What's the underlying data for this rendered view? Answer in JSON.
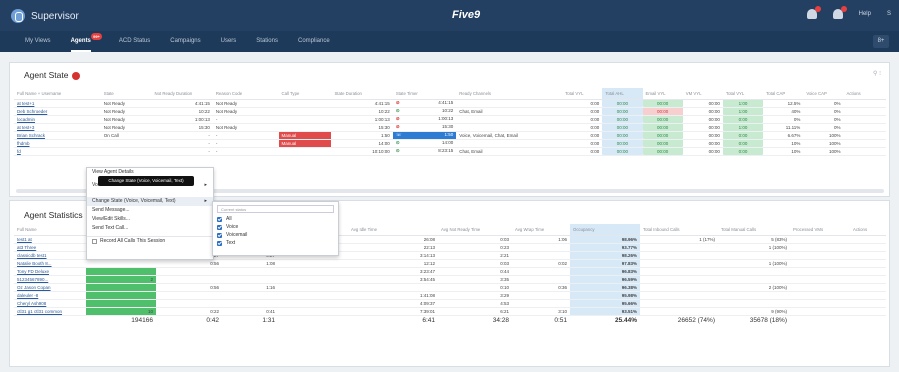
{
  "app": {
    "title": "Supervisor",
    "logo_text": "Five9",
    "help": "Help",
    "user_initial": "S"
  },
  "nav": {
    "items": [
      "My Views",
      "Agents",
      "ACD Status",
      "Campaigns",
      "Users",
      "Stations",
      "Compliance"
    ],
    "agents_badge": "99+",
    "right_btn": "8+"
  },
  "agent_state": {
    "title": "Agent State",
    "columns": [
      "Full Name + Username",
      "State",
      "Not Ready Duration",
      "Reason Code",
      "Call Type",
      "State Duration",
      "State Timer",
      "Ready Channels",
      "Total VYL",
      "Total AHL",
      "Email VYL",
      "VM VYL",
      "Total VYL",
      "Total CAP",
      "Voice CAP",
      "Actions"
    ],
    "rows": [
      {
        "name": "at test+1",
        "state": "Not Ready",
        "nrd": "4:41:15",
        "reason": "Not Ready",
        "call": "",
        "sd": "4:41:15",
        "timer": "4:41:15",
        "timer_icon": "red",
        "channels": "",
        "c1": "0:00",
        "c2": "00:00",
        "c3": "00:00",
        "c4": "00:00",
        "c5": "1:00",
        "c6": "12.5%",
        "c7": "0%",
        "c2c": "g",
        "c3c": "g",
        "c5c": "g"
      },
      {
        "name": "Deb Schroeder",
        "state": "Not Ready",
        "nrd": "10:22",
        "reason": "Not Ready",
        "call": "",
        "sd": "10:22",
        "timer": "10:22",
        "timer_icon": "green",
        "channels": "Chat, Email",
        "c1": "0:00",
        "c2": "00:00",
        "c3": "00:00",
        "c4": "00:00",
        "c5": "1:00",
        "c6": "40%",
        "c7": "0%",
        "c2c": "g",
        "c3c": "r",
        "c5c": "g"
      },
      {
        "name": "locadmin",
        "state": "Not Ready",
        "nrd": "1:00:13",
        "reason": "-",
        "call": "",
        "sd": "1:00:13",
        "timer": "1:00:13",
        "timer_icon": "red",
        "channels": "",
        "c1": "0:00",
        "c2": "00:00",
        "c3": "00:00",
        "c4": "00:00",
        "c5": "0:00",
        "c6": "0%",
        "c7": "0%",
        "c2c": "g",
        "c3c": "g",
        "c5c": "g"
      },
      {
        "name": "at test+3",
        "state": "Not Ready",
        "nrd": "15:30",
        "reason": "Not Ready",
        "call": "",
        "sd": "15:30",
        "timer": "15:30",
        "timer_icon": "red",
        "channels": "",
        "c1": "0:00",
        "c2": "00:00",
        "c3": "00:00",
        "c4": "00:00",
        "c5": "1:00",
        "c6": "11.11%",
        "c7": "0%",
        "c2c": "g",
        "c3c": "g",
        "c5c": "g"
      },
      {
        "name": "Brian Schrack",
        "state": "On Call",
        "nrd": "-",
        "reason": "-",
        "call": "Manual",
        "sd": "1:50",
        "timer": "1:50",
        "timer_icon": "blue",
        "channels": "Voice, Voicemail, Chat, Email",
        "c1": "0:00",
        "c2": "00:00",
        "c3": "00:00",
        "c4": "00:00",
        "c5": "0:00",
        "c6": "6.67%",
        "c7": "100%",
        "c2c": "g",
        "c3c": "g",
        "c5c": "g"
      },
      {
        "name": "fhdmb",
        "state": "",
        "nrd": "-",
        "reason": "-",
        "call": "Manual",
        "sd": "14:00",
        "timer": "14:00",
        "timer_icon": "green",
        "channels": "",
        "c1": "0:00",
        "c2": "00:00",
        "c3": "00:00",
        "c4": "00:00",
        "c5": "0:00",
        "c6": "10%",
        "c7": "100%",
        "c2c": "g",
        "c3c": "g",
        "c5c": "g"
      },
      {
        "name": "fd",
        "state": "",
        "nrd": "-",
        "reason": "-",
        "call": "",
        "sd": "10:10:00",
        "timer": "8:23:15",
        "timer_icon": "green",
        "channels": "Chat, Email",
        "c1": "0:00",
        "c2": "00:00",
        "c3": "00:00",
        "c4": "00:00",
        "c5": "0:00",
        "c6": "10%",
        "c7": "100%",
        "c2c": "g",
        "c3c": "g",
        "c5c": "g"
      }
    ]
  },
  "context_menu": {
    "items": [
      "View Agent Details",
      "Voi",
      "Change State (Voice, Voicemail, Text)",
      "Send Message...",
      "View/Edit Skills...",
      "Send Text Call...",
      "Record All Calls This Session"
    ],
    "tooltip": "Change State (Voice, Voicemail, Text)",
    "submenu": {
      "placeholder": "Current status",
      "options": [
        "All",
        "Voice",
        "Voicemail",
        "Text"
      ]
    }
  },
  "agent_statistics": {
    "title": "Agent Statistics",
    "columns": [
      "Full Name",
      "",
      "",
      "",
      "",
      "Avg Idle Time",
      "Avg Not Ready Time",
      "Avg Wrap Time",
      "Occupancy",
      "Total Inbound Calls",
      "Total Manual Calls",
      "Processed VMs",
      "Actions"
    ],
    "rows": [
      {
        "name": "test1 at",
        "a": "",
        "b": "",
        "c": "",
        "d": "",
        "idle": "26:08",
        "nr": "0:03",
        "wrap": "1:06",
        "occ": "98.96%",
        "inb": "1 (17%)",
        "man": "5 (83%)",
        "vm": ""
      },
      {
        "name": "at3 Three",
        "a": "",
        "b": "",
        "c": "2:42",
        "d": "",
        "idle": "22:13",
        "nr": "0:23",
        "wrap": "",
        "occ": "93.77%",
        "inb": "",
        "man": "1 (100%)",
        "vm": ""
      },
      {
        "name": "classicdb test1",
        "a": "",
        "b": "0:27",
        "c": "0:27",
        "d": "",
        "idle": "3:14:13",
        "nr": "2:21",
        "wrap": "",
        "occ": "98.26%",
        "inb": "",
        "man": "",
        "vm": ""
      },
      {
        "name": "Natalie Booth 8...",
        "a": "",
        "b": "0:56",
        "c": "1:08",
        "d": "",
        "idle": "12:12",
        "nr": "0:03",
        "wrap": "0:02",
        "occ": "97.83%",
        "inb": "",
        "man": "1 (100%)",
        "vm": ""
      },
      {
        "name": "Tony FD Deluxe",
        "a": "",
        "b": "",
        "c": "",
        "d": "",
        "idle": "3:23:47",
        "nr": "0:44",
        "wrap": "",
        "occ": "96.83%",
        "inb": "",
        "man": "",
        "vm": ""
      },
      {
        "name": "51234567890...",
        "a": "2",
        "b": "",
        "c": "",
        "d": "",
        "idle": "3:54:45",
        "nr": "3:35",
        "wrap": "",
        "occ": "96.59%",
        "inb": "",
        "man": "",
        "vm": ""
      },
      {
        "name": "Oz Jason Copan",
        "a": "",
        "b": "0:56",
        "c": "1:16",
        "d": "",
        "idle": "",
        "nr": "0:10",
        "wrap": "0:36",
        "occ": "96.38%",
        "inb": "",
        "man": "2 (100%)",
        "vm": ""
      },
      {
        "name": "daleuler -8",
        "a": "",
        "b": "",
        "c": "",
        "d": "",
        "idle": "1:41:08",
        "nr": "3:29",
        "wrap": "",
        "occ": "95.98%",
        "inb": "",
        "man": "",
        "vm": ""
      },
      {
        "name": "Cheryl Ash908",
        "a": "",
        "b": "",
        "c": "",
        "d": "",
        "idle": "4:09:37",
        "nr": "4:53",
        "wrap": "",
        "occ": "95.66%",
        "inb": "",
        "man": "",
        "vm": ""
      },
      {
        "name": "ctl31 g1 ctl31 common",
        "a": "10",
        "b": "0:22",
        "c": "0:41",
        "d": "",
        "idle": "7:39:01",
        "nr": "6:21",
        "wrap": "3:10",
        "occ": "93.51%",
        "inb": "",
        "man": "9 (90%)",
        "vm": ""
      }
    ],
    "totals": {
      "t1": "194166",
      "t2": "0:42",
      "t3": "1:31",
      "t4": "6:41",
      "t5": "34:28",
      "t6": "0:51",
      "t7": "25.44%",
      "t8": "26652 (74%)",
      "t9": "35678 (18%)"
    }
  }
}
